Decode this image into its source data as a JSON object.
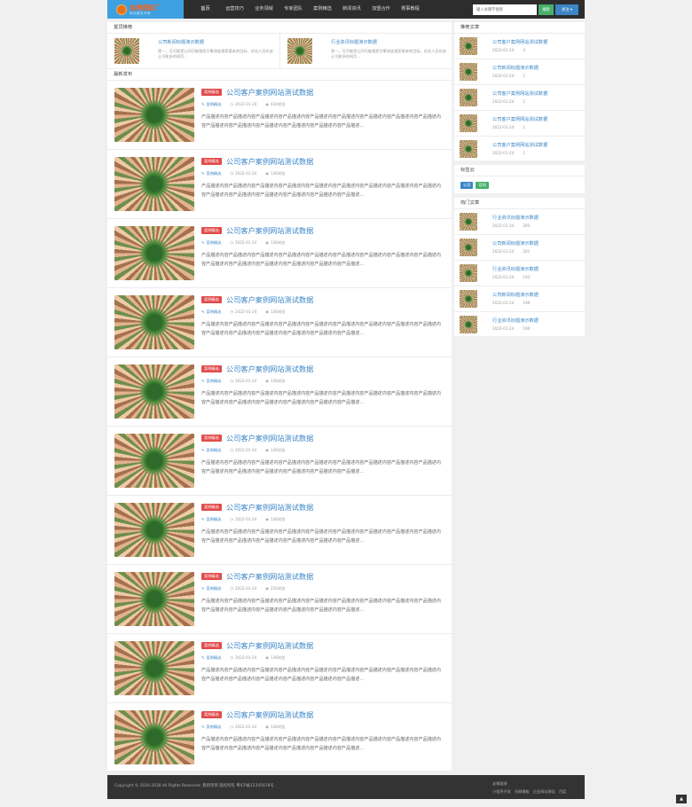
{
  "header": {
    "logo_name": "金牌模板厂",
    "logo_slogan": "网站建设专家",
    "nav": [
      "首页",
      "运营技巧",
      "业务领域",
      "专家团队",
      "案例精选",
      "新闻资讯",
      "加盟合作",
      "赛事教程"
    ],
    "search_placeholder": "输入关键字搜索",
    "search_label": "搜索",
    "follow_label": "关注 ▾"
  },
  "top_pick": {
    "title": "置顶推荐",
    "items": [
      {
        "title": "公司新闻标题演示数据",
        "summary": "第一，可可能是让同可能搜索引擎改变搜索基本的目标，优化人员应该让可能多的网页..."
      },
      {
        "title": "行业资讯标题演示数据",
        "summary": "第一，可可能是让同可能搜索引擎改变搜索基本的目标，优化人员应该让可能多的网页..."
      }
    ]
  },
  "latest": {
    "title": "最新发布",
    "articles": [
      {
        "category": "案例精选",
        "title": "公司客户案例网站测试数据",
        "tag": "案例精选",
        "date": "2022-01-24",
        "views": "420浏览",
        "desc": "产品描述内容产品描述内容产品描述内容产品描述内容产品描述内容产品描述内容产品描述内容产品描述内容产品描述内容产品描述内容产品描述内容产品描述内容产品描述内容产品描述内容产品描述..."
      },
      {
        "category": "案例精选",
        "title": "公司客户案例网站测试数据",
        "tag": "案例精选",
        "date": "2022-01-24",
        "views": "136浏览",
        "desc": "产品描述内容产品描述内容产品描述内容产品描述内容产品描述内容产品描述内容产品描述内容产品描述内容产品描述内容产品描述内容产品描述内容产品描述内容产品描述内容产品描述内容产品描述..."
      },
      {
        "category": "案例精选",
        "title": "公司客户案例网站测试数据",
        "tag": "案例精选",
        "date": "2022-01-24",
        "views": "136浏览",
        "desc": "产品描述内容产品描述内容产品描述内容产品描述内容产品描述内容产品描述内容产品描述内容产品描述内容产品描述内容产品描述内容产品描述内容产品描述内容产品描述内容产品描述内容产品描述..."
      },
      {
        "category": "案例精选",
        "title": "公司客户案例网站测试数据",
        "tag": "案例精选",
        "date": "2022-01-24",
        "views": "136浏览",
        "desc": "产品描述内容产品描述内容产品描述内容产品描述内容产品描述内容产品描述内容产品描述内容产品描述内容产品描述内容产品描述内容产品描述内容产品描述内容产品描述内容产品描述内容产品描述..."
      },
      {
        "category": "案例精选",
        "title": "公司客户案例网站测试数据",
        "tag": "案例精选",
        "date": "2022-01-24",
        "views": "136浏览",
        "desc": "产品描述内容产品描述内容产品描述内容产品描述内容产品描述内容产品描述内容产品描述内容产品描述内容产品描述内容产品描述内容产品描述内容产品描述内容产品描述内容产品描述内容产品描述..."
      },
      {
        "category": "案例精选",
        "title": "公司客户案例网站测试数据",
        "tag": "案例精选",
        "date": "2022-01-24",
        "views": "136浏览",
        "desc": "产品描述内容产品描述内容产品描述内容产品描述内容产品描述内容产品描述内容产品描述内容产品描述内容产品描述内容产品描述内容产品描述内容产品描述内容产品描述内容产品描述内容产品描述..."
      },
      {
        "category": "案例精选",
        "title": "公司客户案例网站测试数据",
        "tag": "案例精选",
        "date": "2022-01-24",
        "views": "136浏览",
        "desc": "产品描述内容产品描述内容产品描述内容产品描述内容产品描述内容产品描述内容产品描述内容产品描述内容产品描述内容产品描述内容产品描述内容产品描述内容产品描述内容产品描述内容产品描述..."
      },
      {
        "category": "案例精选",
        "title": "公司客户案例网站测试数据",
        "tag": "案例精选",
        "date": "2022-01-24",
        "views": "235浏览",
        "desc": "产品描述内容产品描述内容产品描述内容产品描述内容产品描述内容产品描述内容产品描述内容产品描述内容产品描述内容产品描述内容产品描述内容产品描述内容产品描述内容产品描述内容产品描述..."
      },
      {
        "category": "案例精选",
        "title": "公司客户案例网站测试数据",
        "tag": "案例精选",
        "date": "2022-01-24",
        "views": "136浏览",
        "desc": "产品描述内容产品描述内容产品描述内容产品描述内容产品描述内容产品描述内容产品描述内容产品描述内容产品描述内容产品描述内容产品描述内容产品描述内容产品描述内容产品描述内容产品描述..."
      },
      {
        "category": "案例精选",
        "title": "公司客户案例网站测试数据",
        "tag": "案例精选",
        "date": "2022-01-24",
        "views": "136浏览",
        "desc": "产品描述内容产品描述内容产品描述内容产品描述内容产品描述内容产品描述内容产品描述内容产品描述内容产品描述内容产品描述内容产品描述内容产品描述内容产品描述内容产品描述内容产品描述..."
      }
    ]
  },
  "sidebar": {
    "recommended": {
      "title": "推荐文章",
      "items": [
        {
          "title": "公司客户案例网站测试数据",
          "date": "2022-01-24",
          "views": "4"
        },
        {
          "title": "公司新闻标题演示数据",
          "date": "2022-01-24",
          "views": "1"
        },
        {
          "title": "公司客户案例网站测试数据",
          "date": "2022-01-24",
          "views": "1"
        },
        {
          "title": "公司客户案例网站测试数据",
          "date": "2022-01-24",
          "views": "1"
        },
        {
          "title": "公司客户案例网站测试数据",
          "date": "2022-01-24",
          "views": "1"
        }
      ]
    },
    "tags": {
      "title": "标签云",
      "items": [
        {
          "label": "公司",
          "color": "#3b86c6"
        },
        {
          "label": "官网",
          "color": "#47b06a"
        }
      ]
    },
    "hot": {
      "title": "热门文章",
      "items": [
        {
          "title": "行业资讯标题演示数据",
          "date": "2022-01-24",
          "views": "205"
        },
        {
          "title": "公司新闻标题演示数据",
          "date": "2022-01-24",
          "views": "201"
        },
        {
          "title": "行业资讯标题演示数据",
          "date": "2022-01-24",
          "views": "193"
        },
        {
          "title": "公司新闻标题演示数据",
          "date": "2022-01-24",
          "views": "190"
        },
        {
          "title": "行业资讯标题演示数据",
          "date": "2022-01-24",
          "views": "190"
        }
      ]
    }
  },
  "footer": {
    "copyright": "Copyright © 2020-2030 All Rights Reserved. 我的项目 版权所有 粤ICP备12345678号",
    "links_title": "友情链接",
    "links": [
      "小程序开发",
      "岳卿模板",
      "企业网站建设",
      "百度"
    ]
  },
  "icons": {
    "tag": "tag-icon",
    "clock": "clock-icon",
    "eye": "eye-icon",
    "back_to_top": "arrow-up-icon"
  },
  "colors": {
    "link": "#3b86c6",
    "category_badge": "#e24b4b",
    "search_button": "#47b06a",
    "follow_button": "#3b86c6",
    "header_bg": "#2d2d2d",
    "logo_bg": "#3da0e0"
  }
}
